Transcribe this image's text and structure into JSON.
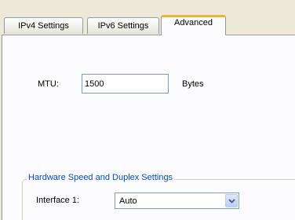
{
  "tabs": [
    "IPv4 Settings",
    "IPv6 Settings",
    "Advanced"
  ],
  "active_tab": "Advanced",
  "mtu": {
    "label": "MTU:",
    "value": "1500",
    "unit": "Bytes"
  },
  "hardware": {
    "group_title": "Hardware Speed and Duplex Settings",
    "interface_label": "Interface 1:",
    "interface_value": "Auto"
  },
  "icons": {
    "dropdown": "chevron-down-icon"
  },
  "colors": {
    "active_tab_accent": "#f0b13c",
    "group_title": "#0046d5",
    "background": "#ece9d8",
    "panel": "#fcfcfe"
  }
}
